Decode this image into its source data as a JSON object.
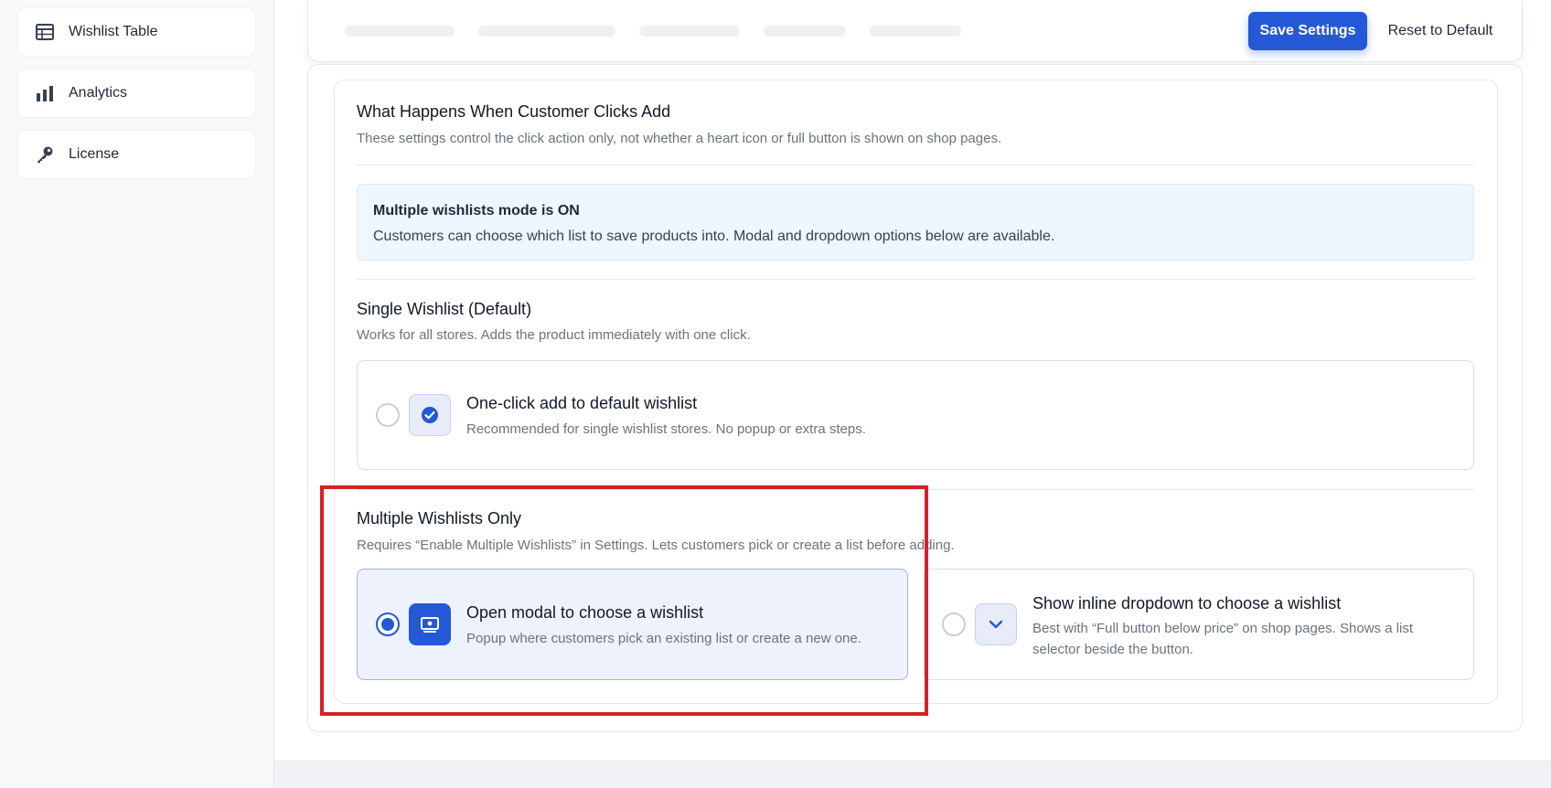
{
  "sidebar": {
    "items": [
      {
        "label": "Wishlist Table",
        "icon": "table-icon"
      },
      {
        "label": "Analytics",
        "icon": "bar-chart-icon"
      },
      {
        "label": "License",
        "icon": "key-icon"
      }
    ]
  },
  "header": {
    "save_label": "Save Settings",
    "reset_label": "Reset to Default"
  },
  "section": {
    "title": "What Happens When Customer Clicks Add",
    "description": "These settings control the click action only, not whether a heart icon or full button is shown on shop pages."
  },
  "info": {
    "title": "Multiple wishlists mode is ON",
    "text": "Customers can choose which list to save products into. Modal and dropdown options below are available."
  },
  "single": {
    "title": "Single Wishlist (Default)",
    "description": "Works for all stores. Adds the product immediately with one click.",
    "option": {
      "title": "One-click add to default wishlist",
      "description": "Recommended for single wishlist stores. No popup or extra steps.",
      "selected": false
    }
  },
  "multiple": {
    "title": "Multiple Wishlists Only",
    "description": "Requires “Enable Multiple Wishlists” in Settings. Lets customers pick or create a list before adding.",
    "options": [
      {
        "title": "Open modal to choose a wishlist",
        "description": "Popup where customers pick an existing list or create a new one.",
        "selected": true
      },
      {
        "title": "Show inline dropdown to choose a wishlist",
        "description": "Best with “Full button below price” on shop pages. Shows a list selector beside the button.",
        "selected": false
      }
    ]
  },
  "colors": {
    "primary": "#2458d6",
    "highlight": "#d6212a",
    "info_bg": "#eef6ff"
  }
}
